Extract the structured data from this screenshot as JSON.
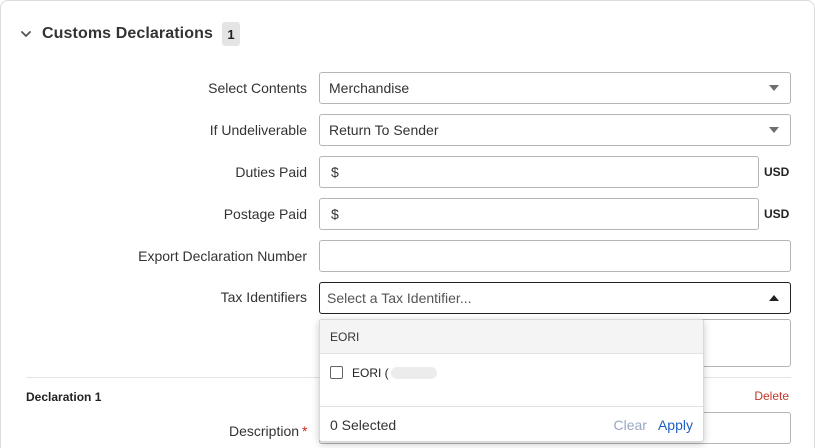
{
  "section": {
    "title": "Customs Declarations",
    "count": "1"
  },
  "fields": {
    "select_contents": {
      "label": "Select Contents",
      "value": "Merchandise"
    },
    "if_undeliverable": {
      "label": "If Undeliverable",
      "value": "Return To Sender"
    },
    "duties_paid": {
      "label": "Duties Paid",
      "prefix": "$",
      "unit": "USD"
    },
    "postage_paid": {
      "label": "Postage Paid",
      "prefix": "$",
      "unit": "USD"
    },
    "export_declaration": {
      "label": "Export Declaration Number",
      "value": ""
    },
    "tax_identifiers": {
      "label": "Tax Identifiers",
      "placeholder": "Select a Tax Identifier..."
    }
  },
  "tax_dropdown": {
    "group_label": "EORI",
    "option_label": "EORI (",
    "selected_count": "0 Selected",
    "clear_label": "Clear",
    "apply_label": "Apply"
  },
  "declaration": {
    "title": "Declaration 1",
    "delete_label": "Delete",
    "description_label": "Description",
    "required_mark": "*"
  },
  "colors": {
    "accent": "#1f5fbf",
    "danger": "#c0392b",
    "required": "#d0261e"
  },
  "icons": {
    "section_toggle": "chevron-down-icon",
    "select_caret": "caret-down-icon",
    "open_caret": "caret-up-icon"
  }
}
